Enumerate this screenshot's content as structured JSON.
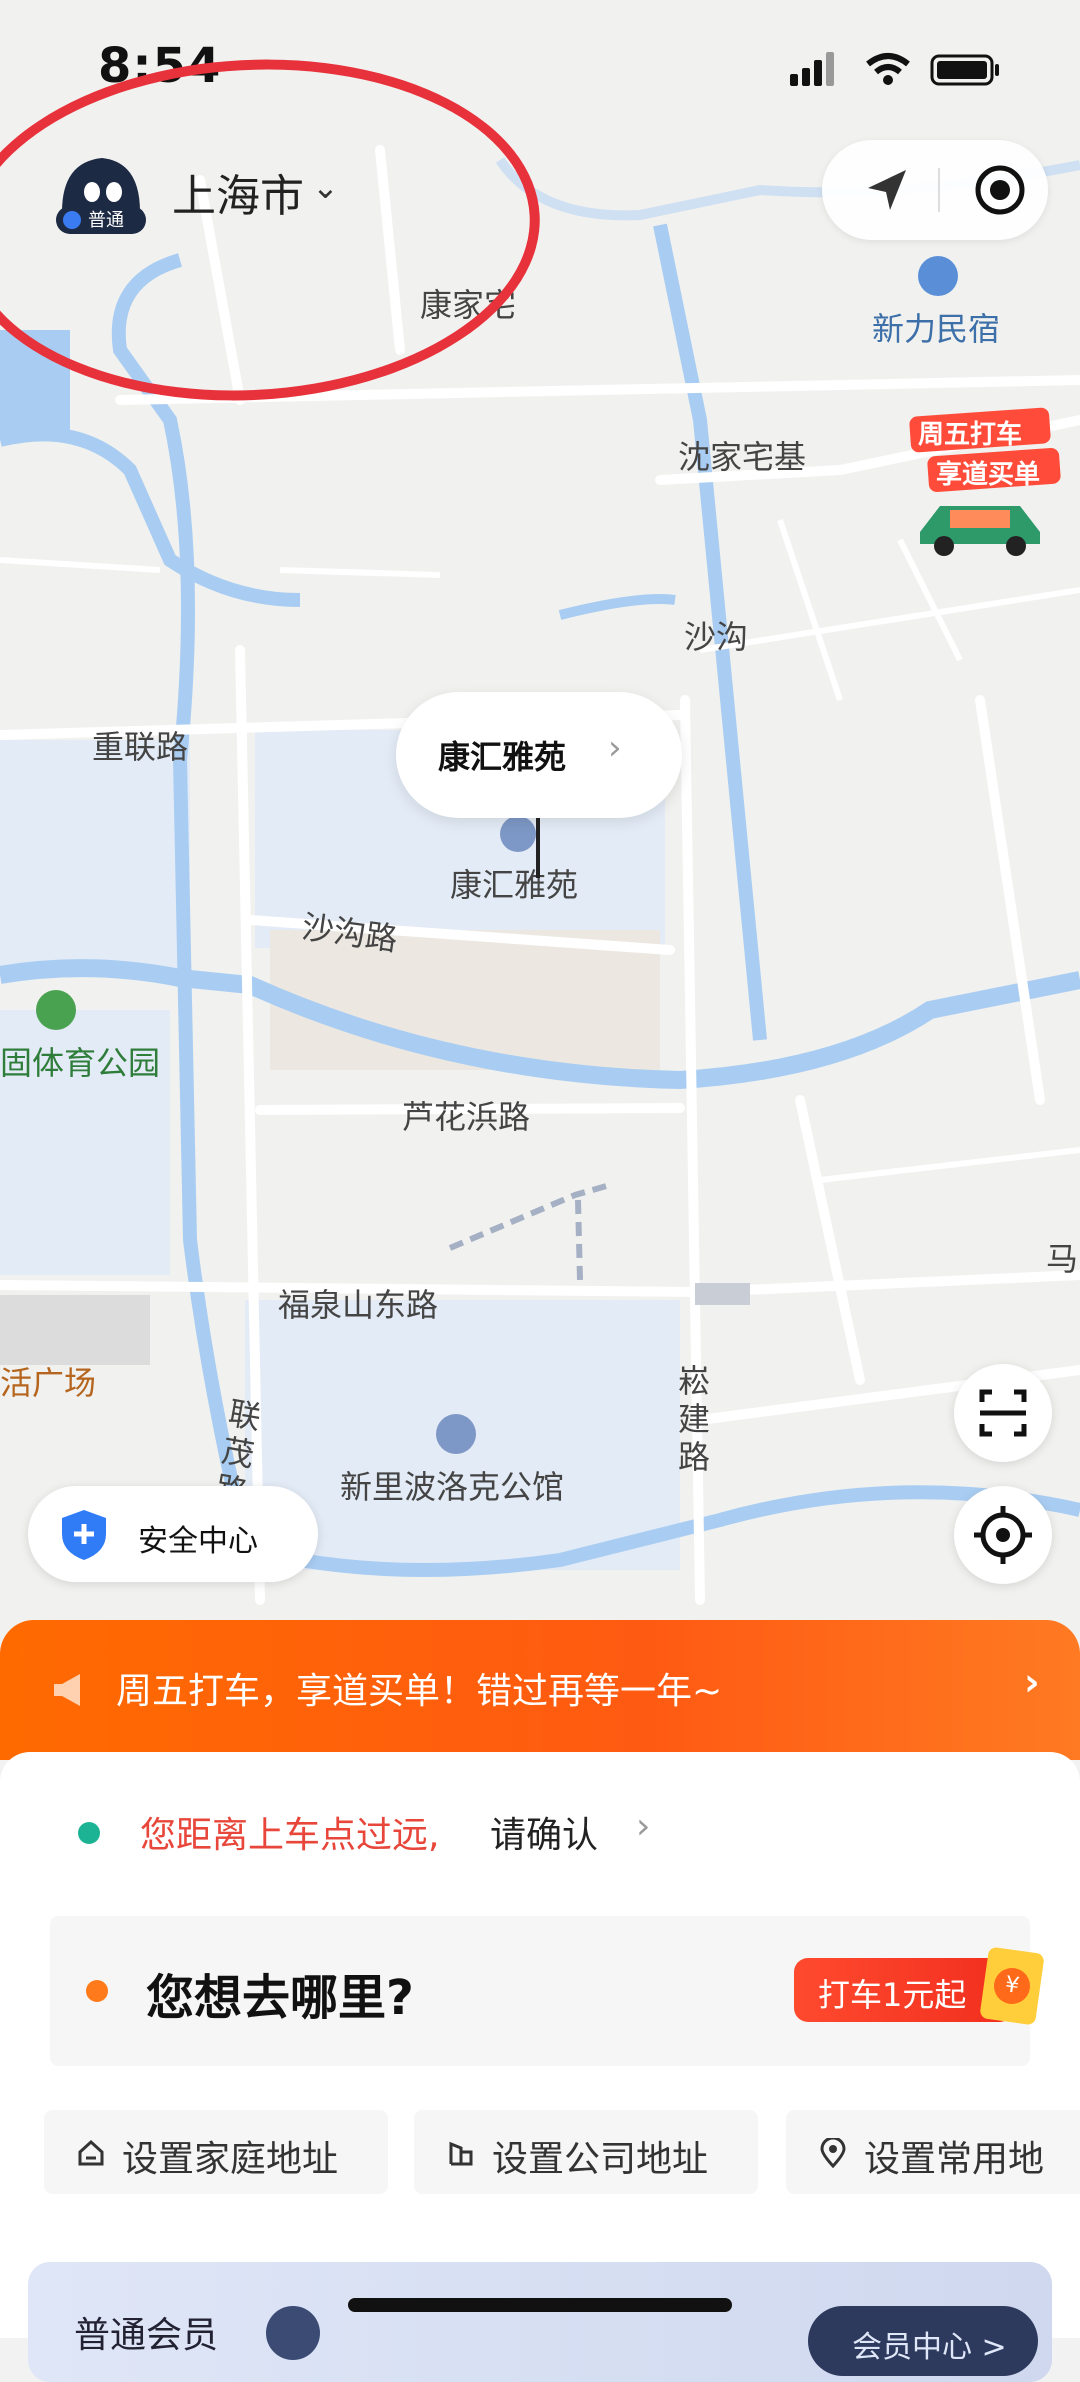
{
  "status_bar": {
    "time": "8:54"
  },
  "header": {
    "avatar_badge": "普通",
    "city": "上海市"
  },
  "map": {
    "labels": {
      "kangjiazhai": "康家宅",
      "xinli_minsu": "新力民宿",
      "shenjiazhaiji": "沈家宅基",
      "shagou": "沙沟",
      "chonglian_rd": "重联路",
      "kanghui_yayuan": "康汇雅苑",
      "shagou_rd": "沙沟路",
      "sports_park": "固体育公园",
      "luhuabang_rd": "芦花浜路",
      "fuquanshan_east_rd": "福泉山东路",
      "plaza": "活广场",
      "songjian_rd": "崧建路",
      "lianmao_rd": "联茂路",
      "hotel": "新里波洛克公馆",
      "ma": "马"
    },
    "pickup_bubble": "康汇雅苑",
    "promo_line1": "周五打车",
    "promo_line2": "享道买单"
  },
  "safety_center": "安全中心",
  "banner": {
    "text": "周五打车，享道买单！错过再等一年~"
  },
  "sheet": {
    "warning_red": "您距离上车点过远,",
    "warning_black": "请确认",
    "destination_prompt": "您想去哪里?",
    "fare_badge": "打车1元起",
    "coin_symbol": "¥",
    "chips": [
      {
        "label": "设置家庭地址"
      },
      {
        "label": "设置公司地址"
      },
      {
        "label": "设置常用地"
      }
    ],
    "member": {
      "label": "普通会员",
      "button": "会员中心 >"
    }
  },
  "colors": {
    "accent_orange": "#ff6a00",
    "warning_red": "#e8463a",
    "map_water": "#a9cdf2",
    "map_block": "#e3ebf6",
    "annotation_red": "#e8323b"
  }
}
